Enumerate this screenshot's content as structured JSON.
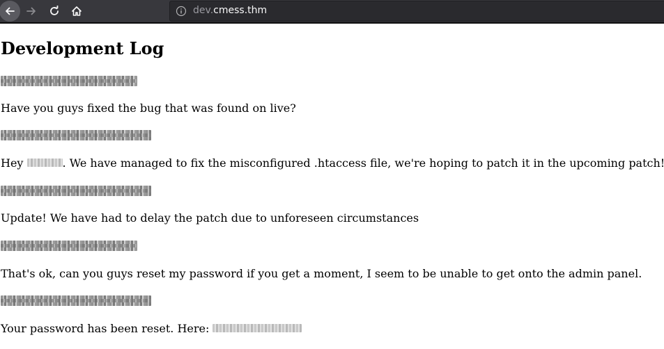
{
  "browser": {
    "url_subdomain": "dev.",
    "url_domain": "cmess.thm",
    "icons": {
      "back": "arrow-left-icon",
      "forward": "arrow-right-icon",
      "reload": "reload-icon",
      "home": "home-icon",
      "info": "info-icon"
    }
  },
  "page": {
    "title": "Development Log",
    "messages": [
      {
        "text_before": "Have you guys fixed the bug that was found on live?",
        "text_after": ""
      },
      {
        "text_before": "Hey ",
        "text_after": ". We have managed to fix the misconfigured .htaccess file, we're hoping to patch it in the upcoming patch!"
      },
      {
        "text_before": "Update! We have had to delay the patch due to unforeseen circumstances",
        "text_after": ""
      },
      {
        "text_before": "That's ok, can you guys reset my password if you get a moment, I seem to be unable to get onto the admin panel.",
        "text_after": ""
      },
      {
        "text_before": "Your password has been reset. Here: ",
        "text_after": ""
      }
    ]
  }
}
